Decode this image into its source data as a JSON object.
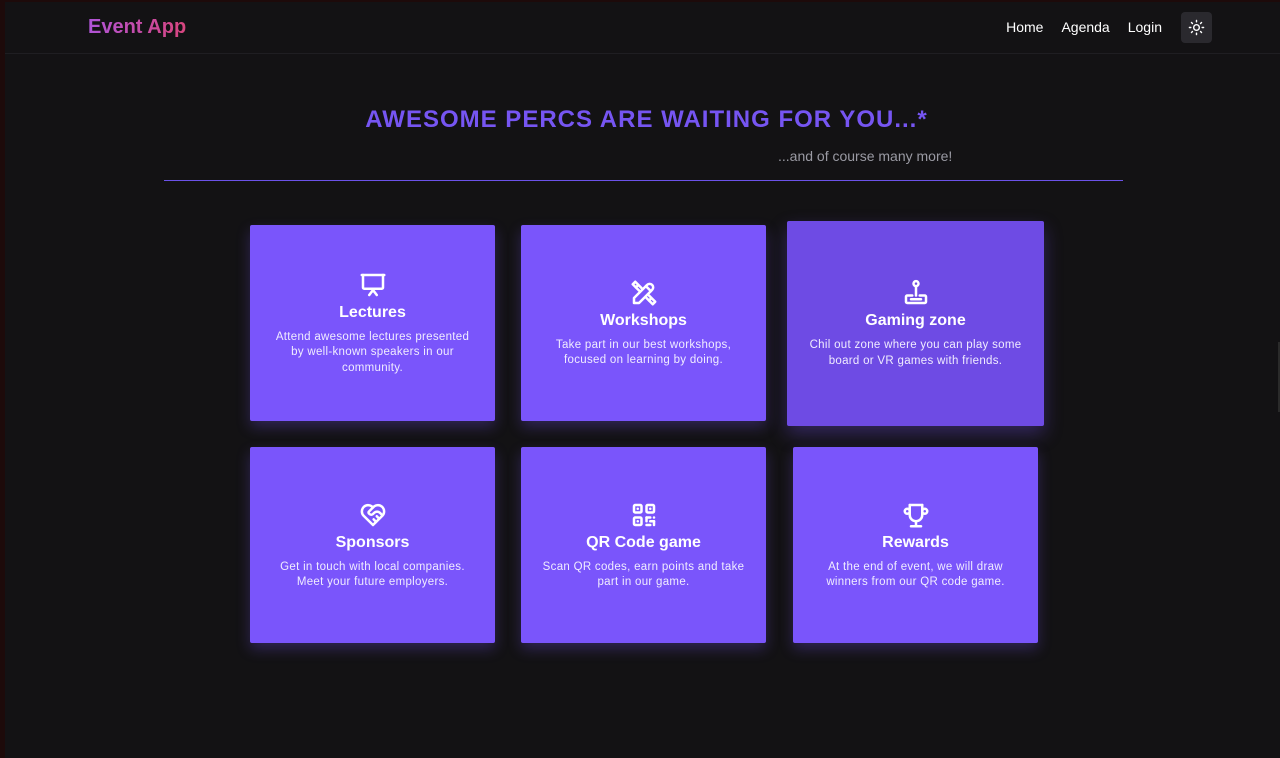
{
  "nav": {
    "brand": "Event App",
    "links": [
      {
        "label": "Home"
      },
      {
        "label": "Agenda"
      },
      {
        "label": "Login"
      }
    ],
    "theme_icon": "sun-icon"
  },
  "hero": {
    "title": "AWESOME PERCS ARE WAITING FOR YOU...*",
    "subtitle": "...and of course many more!"
  },
  "colors": {
    "accent": "#7655f2",
    "card": "#7a55fb",
    "card_hover": "#6e4be4",
    "background": "#131214"
  },
  "cards": [
    {
      "title": "Lectures",
      "desc": "Attend awesome lectures presented by well-known speakers in our community.",
      "icon": "presentation-icon"
    },
    {
      "title": "Workshops",
      "desc": "Take part in our best workshops, focused on learning by doing.",
      "icon": "pencil-ruler-icon"
    },
    {
      "title": "Gaming zone",
      "desc": "Chil out zone where you can play some board or VR games with friends.",
      "icon": "joystick-icon"
    },
    {
      "title": "Sponsors",
      "desc": "Get in touch with local companies. Meet your future employers.",
      "icon": "heart-handshake-icon"
    },
    {
      "title": "QR Code game",
      "desc": "Scan QR codes, earn points and take part in our game.",
      "icon": "qr-code-icon"
    },
    {
      "title": "Rewards",
      "desc": "At the end of event, we will draw winners from our QR code game.",
      "icon": "trophy-icon"
    }
  ]
}
